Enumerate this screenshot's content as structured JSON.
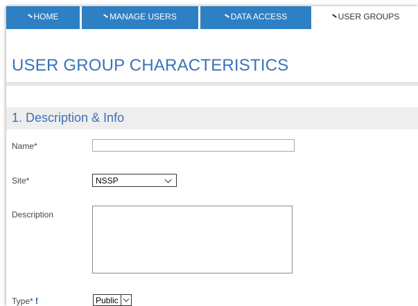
{
  "tabs": [
    {
      "label": "HOME"
    },
    {
      "label": "MANAGE USERS"
    },
    {
      "label": "DATA ACCESS"
    },
    {
      "label": "USER GROUPS"
    }
  ],
  "page": {
    "title": "USER GROUP CHARACTERISTICS"
  },
  "section": {
    "title": "1. Description & Info"
  },
  "form": {
    "name": {
      "label": "Name*",
      "value": ""
    },
    "site": {
      "label": "Site*",
      "value": "NSSP"
    },
    "description": {
      "label": "Description",
      "value": ""
    },
    "type": {
      "label": "Type*",
      "value": "Public"
    }
  },
  "colors": {
    "tab": "#2e80c4",
    "heading": "#3a73b5",
    "section_bg": "#eeeeee"
  }
}
